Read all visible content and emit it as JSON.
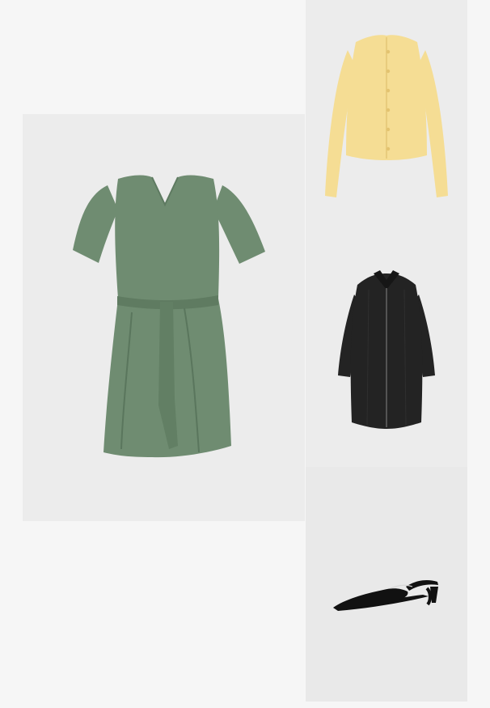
{
  "page": {
    "background": "#f6f6f6"
  },
  "products": [
    {
      "id": "dress",
      "type": "green-belted-dress",
      "image_color": "#6f8c71",
      "tile_color": "#ececec"
    },
    {
      "id": "cardigan",
      "type": "yellow-cardigan",
      "image_color": "#f5dd94",
      "tile_color": "#ececec"
    },
    {
      "id": "coat",
      "type": "black-long-coat",
      "image_color": "#232323",
      "tile_color": "#ececec"
    },
    {
      "id": "shoe",
      "type": "black-slingback-heel",
      "image_color": "#111111",
      "tile_color": "#e9e9e9"
    }
  ]
}
